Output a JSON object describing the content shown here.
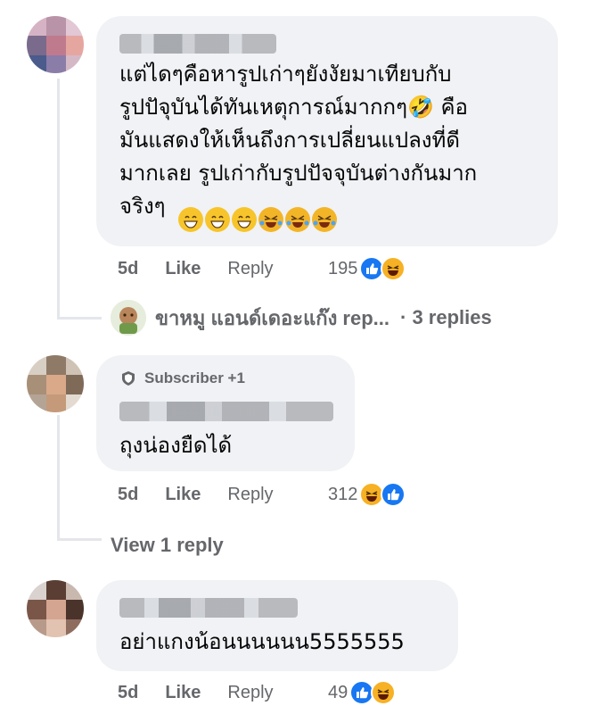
{
  "comments": [
    {
      "text_lines": [
        "แต่ไดๆคือหารูปเก่าๆยังงัยมาเทียบกับ",
        "รูปปัจุบันได้ทันเหตุการณ์มากกๆ🤣 คือ",
        "มันแสดงให้เห็นถึงการเปลี่ยนแปลงที่ดี",
        "มากเลย รูปเก่ากับรูปปัจจุบันต่างกันมาก",
        "จริงๆ"
      ],
      "time": "5d",
      "like_label": "Like",
      "reply_label": "Reply",
      "reaction_count": "195",
      "reactions": [
        "like-icon",
        "haha-icon"
      ],
      "replies_preview": {
        "name": "ขาหมู แอนด์เดอะแก๊ง rep...",
        "count_text": "· 3 replies"
      }
    },
    {
      "badge": "Subscriber +1",
      "text_lines": [
        "ถุงน่องยืดได้"
      ],
      "time": "5d",
      "like_label": "Like",
      "reply_label": "Reply",
      "reaction_count": "312",
      "reactions": [
        "haha-icon",
        "like-icon"
      ],
      "view_replies": "View 1 reply"
    },
    {
      "text_lines": [
        "อย่าแกงน้อนนนนนน5555555"
      ],
      "time": "5d",
      "like_label": "Like",
      "reply_label": "Reply",
      "reaction_count": "49",
      "reactions": [
        "like-icon",
        "haha-icon"
      ]
    }
  ],
  "colors": {
    "bubble": "#f0f2f5",
    "text": "#050505",
    "meta": "#65676b",
    "like_blue": "#1877f2",
    "haha_yellow": "#f7b125"
  }
}
